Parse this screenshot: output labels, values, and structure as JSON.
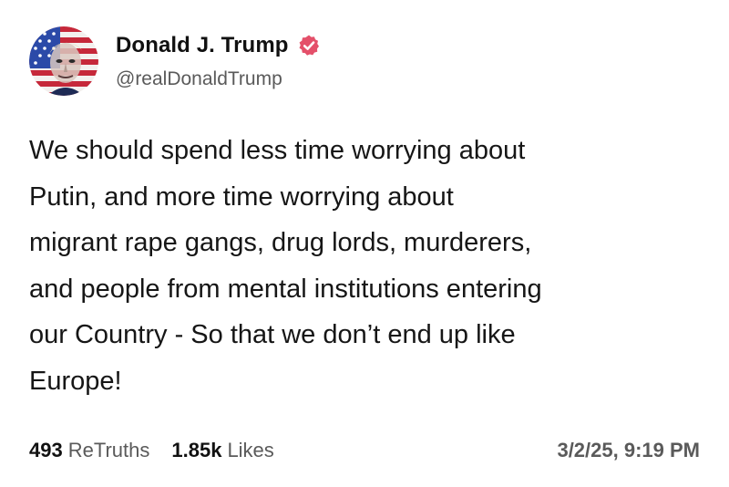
{
  "author": {
    "display_name": "Donald J. Trump",
    "handle": "@realDonaldTrump",
    "avatar_icon": "flag-portrait-avatar",
    "verified_icon": "verified-badge-icon",
    "verified_color": "#e4506a"
  },
  "post": {
    "lines": [
      "We should spend less time worrying about",
      "Putin, and more time worrying about",
      "migrant rape gangs, drug lords, murderers,",
      "and people from mental institutions entering",
      "our Country - So that we don’t end up like",
      "Europe!"
    ]
  },
  "stats": {
    "retruths_count": "493",
    "retruths_label": "ReTruths",
    "likes_count": "1.85k",
    "likes_label": "Likes"
  },
  "timestamp": "3/2/25, 9:19 PM"
}
